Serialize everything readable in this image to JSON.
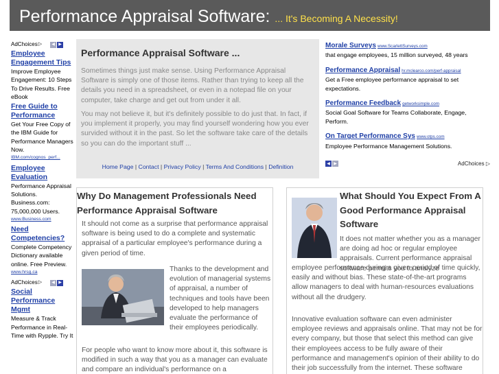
{
  "header": {
    "title": "Performance Appraisal Software:",
    "tagline": "... It's Becoming A Necessity!"
  },
  "left_ads": {
    "adchoices": "AdChoices",
    "ads": [
      {
        "title": "Employee Engagement Tips",
        "desc": "Improve Employee Engagement: 10 Steps To Drive Results. Free eBook",
        "url": ""
      },
      {
        "title": "Free Guide to Performance",
        "desc": "Get Your Free Copy of the IBM Guide for Performance Managers Now.",
        "url": "IBM.com/cognos_perf..."
      },
      {
        "title": "Employee Evaluation",
        "desc": "Performance Appraisal Solutions. Business.com: 75,000,000 Users.",
        "url": "www.Business.com"
      },
      {
        "title": "Need Competencies?",
        "desc": "Complete Competency Dictionary available online. Free Preview.",
        "url": "www.hrsg.ca"
      }
    ],
    "adchoices2": "AdChoices",
    "ads2": [
      {
        "title": "Social Performance Mgmt",
        "desc": "Measure & Track Performance in Real-Time with Rypple. Try It"
      }
    ]
  },
  "intro": {
    "title": "Performance Appraisal Software ...",
    "p1": "Sometimes things just make sense. Using Performance Appraisal Software is simply one of those items. Rather than trying to keep all the details you need in a spreadsheet, or even in a notepad file on your computer, take charge and get out from under it all.",
    "p2": "You may not believe it, but it's definitely possible to do just that. In fact, if you implement it properly, you may find yourself wondering how you ever survided without it in the past. So let the software take care of the details so you can do the important stuff ...",
    "links": [
      "Home Page",
      "Contact",
      "Privacy Policy",
      "Terms And Conditions",
      "Definition"
    ],
    "sep": " | "
  },
  "right_ads": {
    "ads": [
      {
        "title": "Morale Surveys",
        "url": "www.ScarlettSurveys.com",
        "desc": "that engage employees, 15 million surveyed, 48 years"
      },
      {
        "title": "Performance Appraisal",
        "url": "hr.mclearco.com/perf-appraisal",
        "desc": "Get a Free employee performance appraisal to set expectations."
      },
      {
        "title": "Performance Feedback",
        "url": "getworksimple.com",
        "desc": "Social Goal Software for Teams Collaborate, Engage, Perform."
      },
      {
        "title": "On Target Performance Sys",
        "url": "www.otps.com",
        "desc": "Employee Performance Management Solutions."
      }
    ],
    "adchoices": "AdChoices"
  },
  "article_left": {
    "title": "Why Do Management Professionals Need Performance Appraisal Software",
    "p1": "It should not come as a surprise that performance appraisal software is being used to do a complete and systematic appraisal of a particular employee's performance during a given period of time.",
    "p2": "Thanks to the development and evolution of managerial systems of appraisal, a number of techniques and tools have been developed to help managers evaluate the performance of their employees periodically.",
    "p3": "For people who want to know more about it, this software is modified in such a way that you as a manager can evaluate and compare an individual's performance on a"
  },
  "article_right": {
    "title": "What Should You Expect From A Good Performance Appraisal Software",
    "p1": "It does not matter whether you as a manager are doing ad hoc or regular employee appraisals. Current performance appraisal software permits you to analyze",
    "p2": "employee performance during a given period of time quickly, easily and without bias. These state-of-the-art programs allow managers to deal with human-resources evaluations without all the drudgery.",
    "p3": "Innovative evaluation software can even administer employee reviews and appraisals online. That may not be for every company, but those that select this method can give their employees access to be fully aware of their performance and management's opinion of their ability to do their job successfully from the internet. These software systems are used to review an employee's performance"
  }
}
